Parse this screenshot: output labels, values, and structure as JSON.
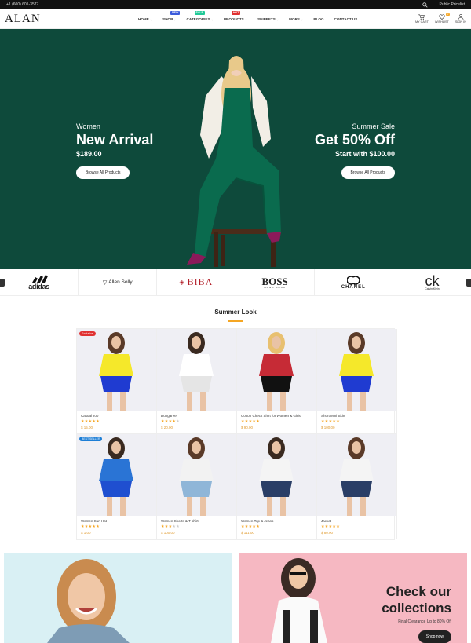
{
  "topbar": {
    "phone": "+1 (600) 601-3577",
    "currency": "Public Pricelist"
  },
  "header": {
    "logo": "ALAN",
    "nav": [
      {
        "label": "HOME",
        "caret": true
      },
      {
        "label": "SHOP",
        "caret": true,
        "badge": "NEW",
        "badge_color": "#3b5bdb"
      },
      {
        "label": "CATEGORIES",
        "caret": true,
        "badge": "SALE",
        "badge_color": "#20c997"
      },
      {
        "label": "PRODUCTS",
        "caret": true,
        "badge": "HOT",
        "badge_color": "#e03131"
      },
      {
        "label": "SNIPPETS",
        "caret": true
      },
      {
        "label": "MORE",
        "caret": true
      },
      {
        "label": "BLOG",
        "caret": false
      },
      {
        "label": "CONTACT US",
        "caret": false
      }
    ],
    "icons": {
      "cart": "MY CART",
      "wishlist": "WISHLIST",
      "signin": "SIGN IN",
      "cart_count": "0"
    }
  },
  "hero": {
    "left": {
      "sub": "Women",
      "title": "New Arrival",
      "price": "$189.00",
      "button": "Browse All Products"
    },
    "right": {
      "sub": "Summer Sale",
      "title": "Get 50% Off",
      "price": "Start with $100.00",
      "button": "Browse All Products"
    }
  },
  "brands": [
    "adidas",
    "Allen Solly",
    "BIBA",
    "BOSS",
    "CHANEL",
    "Calvin Klein"
  ],
  "brand_sub": {
    "boss": "HUGO BOSS"
  },
  "section": {
    "title": "Summer Look"
  },
  "products": [
    {
      "name": "Casual Top",
      "rating": 5,
      "price": "$ 15.00",
      "tag": "Exclusive",
      "tag_color": "#e03131"
    },
    {
      "name": "Dungaree",
      "rating": 4,
      "price": "$ 20.00"
    },
    {
      "name": "Cotton Check Shirt for Women & Girls",
      "rating": 5,
      "price": "$ 90.00"
    },
    {
      "name": "Short Mini Skirt",
      "rating": 5,
      "price": "$ 100.00"
    },
    {
      "name": "Women Sun Hat",
      "rating": 5,
      "price": "$ 1.00",
      "tag": "BEST SELLER",
      "tag_color": "#1c7ed6"
    },
    {
      "name": "Women Shorts & T-shirt",
      "rating": 3,
      "price": "$ 100.00"
    },
    {
      "name": "Women Top & Jeans",
      "rating": 5,
      "price": "$ 111.00"
    },
    {
      "name": "Jacket",
      "rating": 5,
      "price": "$ 80.00"
    }
  ],
  "promo": {
    "heading_1": "Check our",
    "heading_2": "collections",
    "sub": "Final Clearance Up to 80% Off",
    "button": "Shop now"
  },
  "colors": {
    "hero_bg": "#0e4a3b",
    "accent": "#f5a623",
    "promo_pink": "#f6b8c2",
    "promo_blue": "#d9f0f4"
  }
}
